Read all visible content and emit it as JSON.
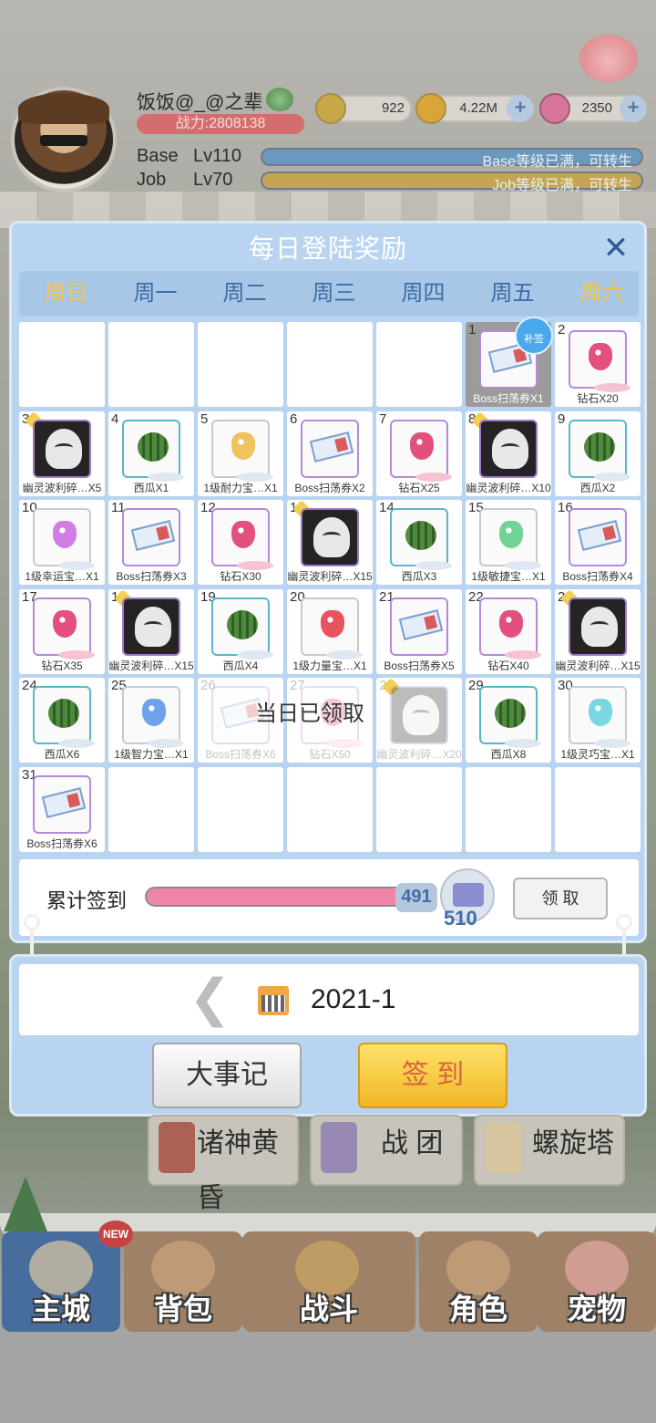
{
  "header": {
    "player_name": "饭饭@_@之辈",
    "power": "战力:2808138",
    "currency": [
      {
        "icon": "zeny-coin-icon",
        "value": "922"
      },
      {
        "icon": "gold-coin-icon",
        "value": "4.22M"
      },
      {
        "icon": "diamond-icon",
        "value": "2350"
      }
    ],
    "base_label": "Base",
    "base_level": "Lv110",
    "base_note": "Base等级已满，可转生",
    "job_label": "Job",
    "job_level": "Lv70",
    "job_note": "Job等级已满，可转生"
  },
  "dialog": {
    "title": "每日登陆奖励",
    "weekdays": [
      "周日",
      "周一",
      "周二",
      "周三",
      "周四",
      "周五",
      "周六"
    ],
    "days": [
      {
        "num": "1",
        "label": "Boss扫荡券X1",
        "item": "ticket",
        "state": "claimed",
        "badge": "补签"
      },
      {
        "num": "2",
        "label": "钻石X20",
        "item": "gem-pink"
      },
      {
        "num": "3",
        "label": "幽灵波利碎…X5",
        "item": "ghost"
      },
      {
        "num": "4",
        "label": "西瓜X1",
        "item": "melon"
      },
      {
        "num": "5",
        "label": "1级耐力宝…X1",
        "item": "gem-yellow"
      },
      {
        "num": "6",
        "label": "Boss扫荡券X2",
        "item": "ticket"
      },
      {
        "num": "7",
        "label": "钻石X25",
        "item": "gem-pink"
      },
      {
        "num": "8",
        "label": "幽灵波利碎…X10",
        "item": "ghost"
      },
      {
        "num": "9",
        "label": "西瓜X2",
        "item": "melon"
      },
      {
        "num": "10",
        "label": "1级幸运宝…X1",
        "item": "gem-violet"
      },
      {
        "num": "11",
        "label": "Boss扫荡券X3",
        "item": "ticket"
      },
      {
        "num": "12",
        "label": "钻石X30",
        "item": "gem-pink"
      },
      {
        "num": "13",
        "label": "幽灵波利碎…X15",
        "item": "ghost"
      },
      {
        "num": "14",
        "label": "西瓜X3",
        "item": "melon"
      },
      {
        "num": "15",
        "label": "1级敏捷宝…X1",
        "item": "gem-green"
      },
      {
        "num": "16",
        "label": "Boss扫荡券X4",
        "item": "ticket"
      },
      {
        "num": "17",
        "label": "钻石X35",
        "item": "gem-pink"
      },
      {
        "num": "18",
        "label": "幽灵波利碎…X15",
        "item": "ghost"
      },
      {
        "num": "19",
        "label": "西瓜X4",
        "item": "melon"
      },
      {
        "num": "20",
        "label": "1级力量宝…X1",
        "item": "gem-red"
      },
      {
        "num": "21",
        "label": "Boss扫荡券X5",
        "item": "ticket"
      },
      {
        "num": "22",
        "label": "钻石X40",
        "item": "gem-pink"
      },
      {
        "num": "23",
        "label": "幽灵波利碎…X15",
        "item": "ghost"
      },
      {
        "num": "24",
        "label": "西瓜X6",
        "item": "melon"
      },
      {
        "num": "25",
        "label": "1级智力宝…X1",
        "item": "gem-blue"
      },
      {
        "num": "26",
        "label": "Boss扫荡券X6",
        "item": "ticket",
        "state": "faded"
      },
      {
        "num": "27",
        "label": "钻石X50",
        "item": "gem-pink",
        "state": "faded"
      },
      {
        "num": "28",
        "label": "幽灵波利碎…X20",
        "item": "ghost",
        "state": "faded"
      },
      {
        "num": "29",
        "label": "西瓜X8",
        "item": "melon"
      },
      {
        "num": "30",
        "label": "1级灵巧宝…X1",
        "item": "gem-cyan"
      },
      {
        "num": "31",
        "label": "Boss扫荡券X6",
        "item": "ticket"
      }
    ],
    "claimed_notice": "当日已领取",
    "accumulated": {
      "label": "累计签到",
      "current": "491",
      "target": "510",
      "progress_fraction": 0.963,
      "claim_button": "领 取"
    },
    "month": "2021-1",
    "history_button": "大事记",
    "signin_button": "签 到"
  },
  "game_buttons": [
    "诸神黄昏",
    "战 团",
    "螺旋塔"
  ],
  "nav": [
    {
      "label": "主城",
      "active": true,
      "badge": "NEW"
    },
    {
      "label": "背包"
    },
    {
      "label": "战斗"
    },
    {
      "label": "角色"
    },
    {
      "label": "宠物"
    }
  ],
  "colors": {
    "dialog_bg": "#b8d4f1",
    "weekday": "#3b6ea6",
    "weekend": "#f5c645",
    "progress_pink": "#ef86a8",
    "signin_gold": "#f3b525"
  }
}
